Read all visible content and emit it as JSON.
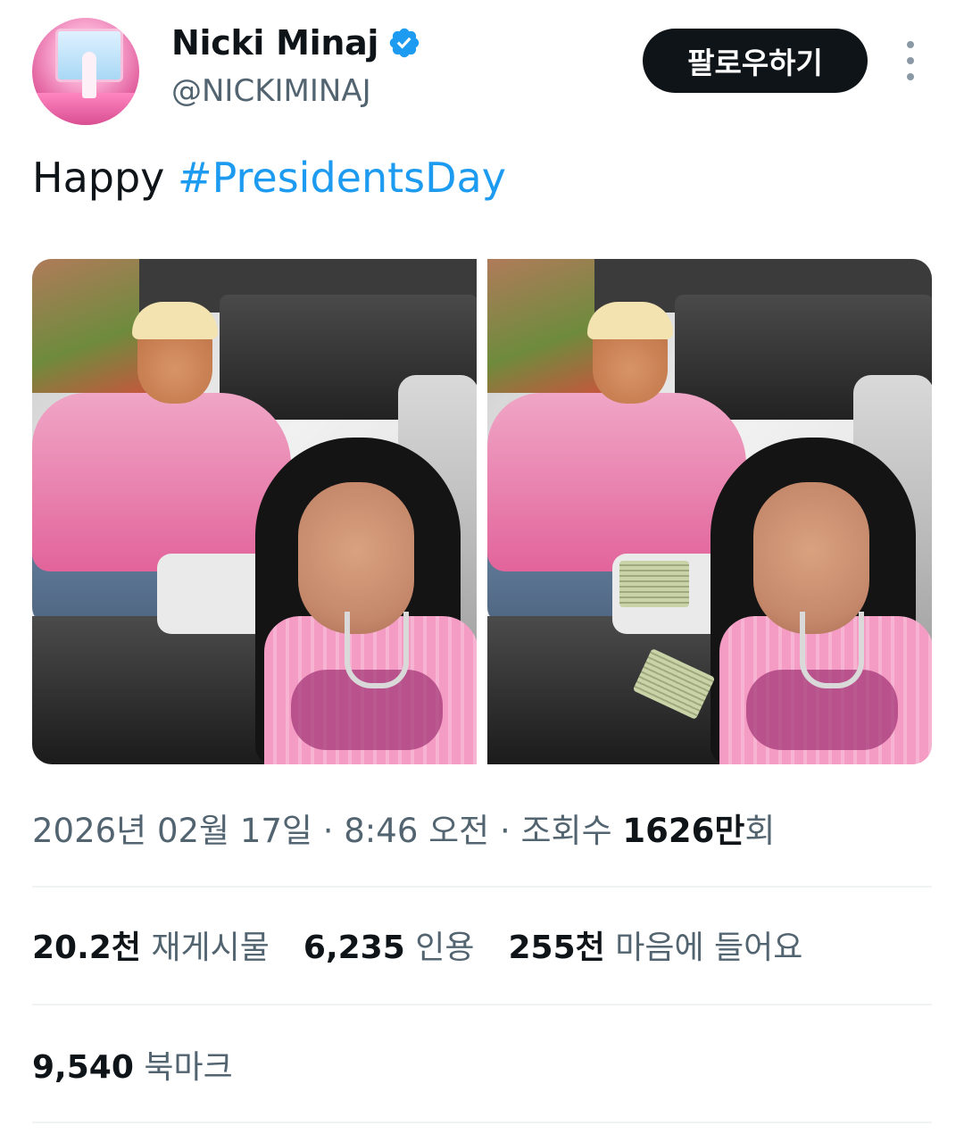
{
  "author": {
    "display_name": "Nicki Minaj",
    "handle": "@NICKIMINAJ",
    "verified_icon": "verified-badge-icon"
  },
  "follow_button": {
    "label": "팔로우하기"
  },
  "more_button": {
    "icon": "more-vertical-icon"
  },
  "tweet": {
    "text_prefix": "Happy ",
    "hashtag": "#PresidentsDay"
  },
  "colors": {
    "link": "#1d9bf0",
    "secondary_text": "#536471",
    "primary_text": "#0f1419",
    "verified": "#1d9bf0",
    "button_bg": "#0f1419"
  },
  "meta": {
    "date": "2026년 02월 17일",
    "sep1": " · ",
    "time": "8:46 오전",
    "sep2": " · ",
    "views_label": "조회수 ",
    "views_number": "1626만",
    "views_suffix": "회"
  },
  "stats": {
    "reposts": {
      "number": "20.2천",
      "label": "재게시물"
    },
    "quotes": {
      "number": "6,235",
      "label": "인용"
    },
    "likes": {
      "number": "255천",
      "label": "마음에 들어요"
    },
    "bookmarks": {
      "number": "9,540",
      "label": "북마크"
    }
  }
}
